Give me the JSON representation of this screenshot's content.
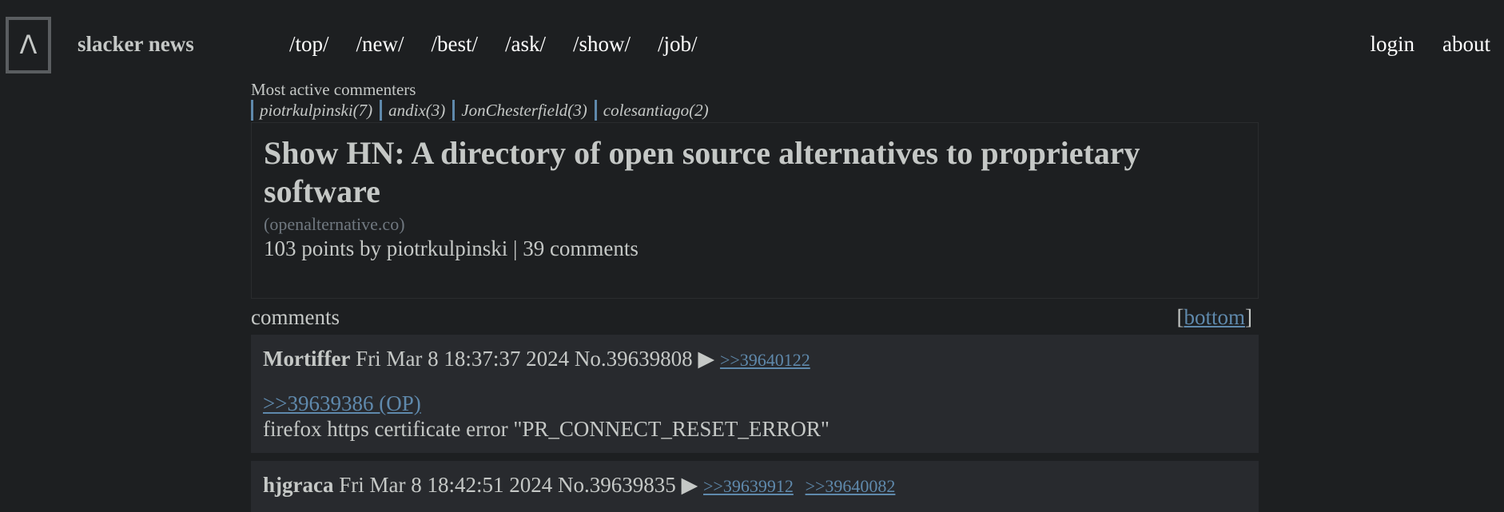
{
  "header": {
    "logo_glyph": "Λ",
    "site_name": "slacker news",
    "nav": [
      "/top/",
      "/new/",
      "/best/",
      "/ask/",
      "/show/",
      "/job/"
    ],
    "right_links": [
      "login",
      "about"
    ]
  },
  "active_commenters": {
    "title": "Most active commenters",
    "items": [
      "piotrkulpinski(7)",
      "andix(3)",
      "JonChesterfield(3)",
      "colesantiago(2)"
    ]
  },
  "story": {
    "title": "Show HN: A directory of open source alternatives to proprietary software",
    "domain": "(openalternative.co)",
    "points": "103 points by",
    "author": "piotrkulpinski",
    "separator": "|",
    "comments_count": "39 comments"
  },
  "comments_section": {
    "label": "comments",
    "bracket_open": "[",
    "bottom_label": "bottom",
    "bracket_close": "]"
  },
  "comments": [
    {
      "author": "Mortiffer",
      "date": "Fri Mar 8 18:37:37 2024",
      "number": "No.39639808",
      "arrow": "▶",
      "replies": [
        ">>39640122"
      ],
      "quote": ">>39639386 (OP)",
      "body": "firefox https certificate error \"PR_CONNECT_RESET_ERROR\""
    },
    {
      "author": "hjgraca",
      "date": "Fri Mar 8 18:42:51 2024",
      "number": "No.39639835",
      "arrow": "▶",
      "replies": [
        ">>39639912",
        ">>39640082"
      ],
      "quote": "",
      "body": ""
    }
  ],
  "colors": {
    "background": "#1d1f21",
    "text": "#c5c8c6",
    "link": "#5f89ac",
    "comment_bg": "#282a2e",
    "muted": "#707880"
  }
}
